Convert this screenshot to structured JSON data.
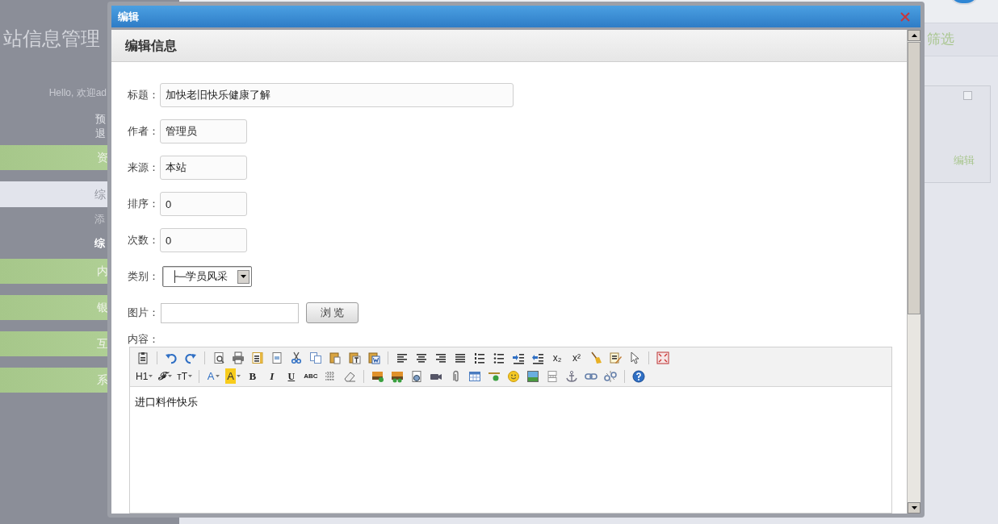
{
  "background": {
    "site_title": "站信息管理",
    "greeting": "Hello, 欢迎ad",
    "links": [
      "预",
      "退"
    ],
    "menu": [
      {
        "label": "资",
        "kind": "group"
      },
      {
        "label": "综",
        "kind": "current"
      },
      {
        "label": "添",
        "kind": "sub",
        "selected": false
      },
      {
        "label": "综",
        "kind": "sub",
        "selected": true
      },
      {
        "label": "内",
        "kind": "group"
      },
      {
        "label": "银",
        "kind": "group"
      },
      {
        "label": "互",
        "kind": "group"
      },
      {
        "label": "系",
        "kind": "group"
      }
    ],
    "filter_label": "筛选",
    "card": {
      "checked": false,
      "action": "编辑"
    }
  },
  "dialog": {
    "title": "编辑",
    "header": "编辑信息",
    "fields": [
      {
        "kind": "longtext",
        "label": "标题：",
        "value": "加快老旧快乐健康了解"
      },
      {
        "kind": "shorttext",
        "label": "作者：",
        "value": "管理员"
      },
      {
        "kind": "shorttext",
        "label": "来源：",
        "value": "本站"
      },
      {
        "kind": "shorttext",
        "label": "排序：",
        "value": "0"
      },
      {
        "kind": "shorttext",
        "label": "次数：",
        "value": "0"
      },
      {
        "kind": "select",
        "label": "类别：",
        "value": "├─学员风采"
      },
      {
        "kind": "file",
        "label": "图片：",
        "button": "浏 览"
      }
    ],
    "content_label": "内容：",
    "toolbar": [
      [
        {
          "kind": "icon"
        },
        {
          "kind": "separator"
        },
        {
          "kind": "icon"
        },
        {
          "kind": "icon"
        },
        {
          "kind": "separator"
        },
        {
          "kind": "icon"
        },
        {
          "kind": "icon"
        },
        {
          "kind": "icon"
        },
        {
          "kind": "icon"
        },
        {
          "kind": "icon"
        },
        {
          "kind": "icon"
        },
        {
          "kind": "icon"
        },
        {
          "kind": "icon"
        },
        {
          "kind": "icon"
        },
        {
          "kind": "separator"
        },
        {
          "kind": "icon"
        },
        {
          "kind": "icon"
        },
        {
          "kind": "icon"
        },
        {
          "kind": "icon"
        },
        {
          "kind": "icon"
        },
        {
          "kind": "icon"
        },
        {
          "kind": "icon"
        },
        {
          "kind": "icon"
        },
        {
          "kind": "plain",
          "label": "x₂",
          "dropdown": false
        },
        {
          "kind": "plain",
          "label": "x²",
          "dropdown": false
        },
        {
          "kind": "icon"
        },
        {
          "kind": "icon"
        },
        {
          "kind": "icon"
        },
        {
          "kind": "separator"
        },
        {
          "kind": "icon"
        }
      ],
      [
        {
          "kind": "plain",
          "label": "H1",
          "dropdown": true
        },
        {
          "kind": "italic",
          "label": "ℱ",
          "dropdown": true
        },
        {
          "kind": "plain",
          "label": "ᴛT",
          "dropdown": true
        },
        {
          "kind": "separator"
        },
        {
          "kind": "color",
          "label": "A",
          "dropdown": true
        },
        {
          "kind": "highlight",
          "label": "A",
          "dropdown": true
        },
        {
          "kind": "bold",
          "label": "B",
          "dropdown": false
        },
        {
          "kind": "italic",
          "label": "I",
          "dropdown": false
        },
        {
          "kind": "underline",
          "label": "U",
          "dropdown": false
        },
        {
          "kind": "small",
          "label": "ABC",
          "dropdown": false
        },
        {
          "kind": "icon"
        },
        {
          "kind": "icon"
        },
        {
          "kind": "separator"
        },
        {
          "kind": "icon"
        },
        {
          "kind": "icon"
        },
        {
          "kind": "icon"
        },
        {
          "kind": "icon"
        },
        {
          "kind": "icon"
        },
        {
          "kind": "icon"
        },
        {
          "kind": "icon"
        },
        {
          "kind": "icon"
        },
        {
          "kind": "icon"
        },
        {
          "kind": "icon"
        },
        {
          "kind": "icon"
        },
        {
          "kind": "icon"
        },
        {
          "kind": "icon"
        },
        {
          "kind": "separator"
        },
        {
          "kind": "icon"
        }
      ]
    ],
    "content": "进口料件快乐"
  }
}
